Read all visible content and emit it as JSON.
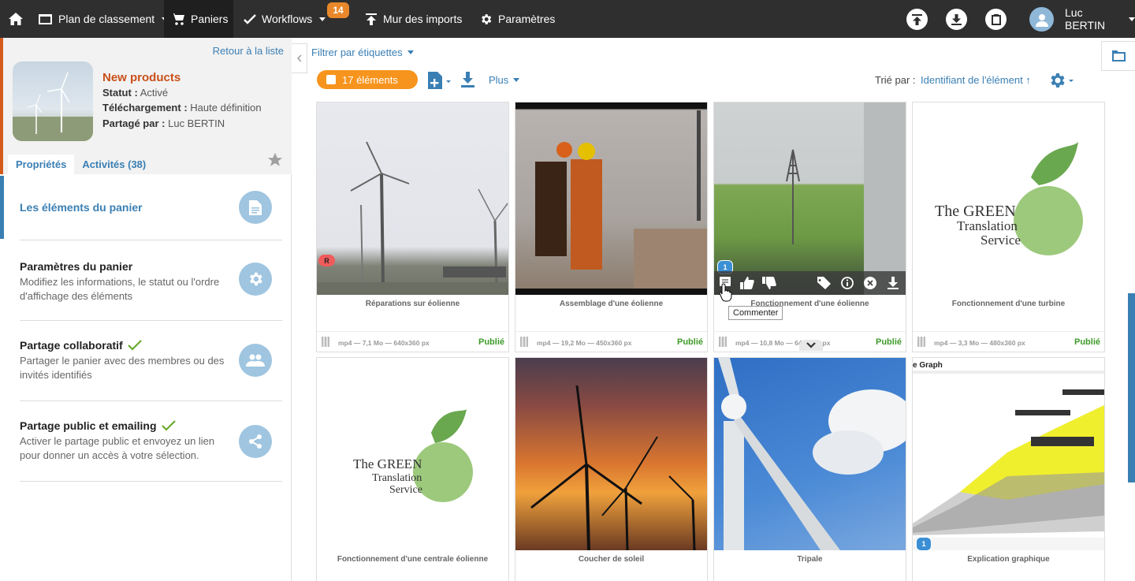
{
  "topbar": {
    "nav": [
      {
        "label": "Plan de classement",
        "icon": "folder-icon"
      },
      {
        "label": "Paniers",
        "icon": "cart-icon"
      },
      {
        "label": "Workflows",
        "icon": "check-icon"
      },
      {
        "label": "Mur des imports",
        "icon": "upload-icon"
      },
      {
        "label": "Paramètres",
        "icon": "gear-icon"
      }
    ],
    "workflows_badge": "14",
    "user_name": "Luc BERTIN",
    "accent_color": "#e8882a"
  },
  "basket": {
    "back_link": "Retour à la liste",
    "title": "New products",
    "status_label": "Statut :",
    "status_value": "Activé",
    "download_label": "Téléchargement :",
    "download_value": "Haute définition",
    "shared_label": "Partagé par :",
    "shared_value": "Luc BERTIN",
    "tabs": [
      "Propriétés",
      "Activités (38)"
    ],
    "title_color": "#c9501a"
  },
  "menu": [
    {
      "title": "Les éléments du panier",
      "desc": "",
      "icon": "document-icon"
    },
    {
      "title": "Paramètres du panier",
      "desc": "Modifiez les informations, le statut ou l'ordre d'affichage des éléments",
      "icon": "gear-icon"
    },
    {
      "title": "Partage collaboratif",
      "desc": "Partager le panier avec des membres ou des invités identifiés",
      "icon": "users-icon"
    },
    {
      "title": "Partage public et emailing",
      "desc": "Activer le partage public et envoyez un lien pour donner un accès à votre sélection.",
      "icon": "share-icon"
    }
  ],
  "toolbar": {
    "filter_label": "Filtrer par étiquettes",
    "count_label": "17 éléments",
    "plus_label": "Plus",
    "sort_label": "Trié par :",
    "sort_value": "Identifiant de l'élément ↑"
  },
  "cards": [
    {
      "title": "Réparations sur éolienne",
      "format": "mp4 — 7,1 Mo — 640x360 px",
      "status": "Publié",
      "badge": "R"
    },
    {
      "title": "Assemblage d'une éolienne",
      "format": "mp4 — 19,2 Mo — 450x360 px",
      "status": "Publié"
    },
    {
      "title": "Fonctionnement d'une éolienne",
      "format": "mp4 — 10,8 Mo — 640x360 px",
      "status": "Publié",
      "badge": "1"
    },
    {
      "title": "Fonctionnement d'une turbine",
      "format": "mp4 — 3,3 Mo — 480x360 px",
      "status": "Publié"
    },
    {
      "title": "Fonctionnement d'une centrale éolienne"
    },
    {
      "title": "Coucher de soleil"
    },
    {
      "title": "Tripale"
    },
    {
      "title": "Explication graphique",
      "badge": "1"
    }
  ],
  "logo_text": [
    "The GREEN",
    "Translation",
    "Service"
  ],
  "graph_title": "e Graph",
  "tooltip": "Commenter"
}
